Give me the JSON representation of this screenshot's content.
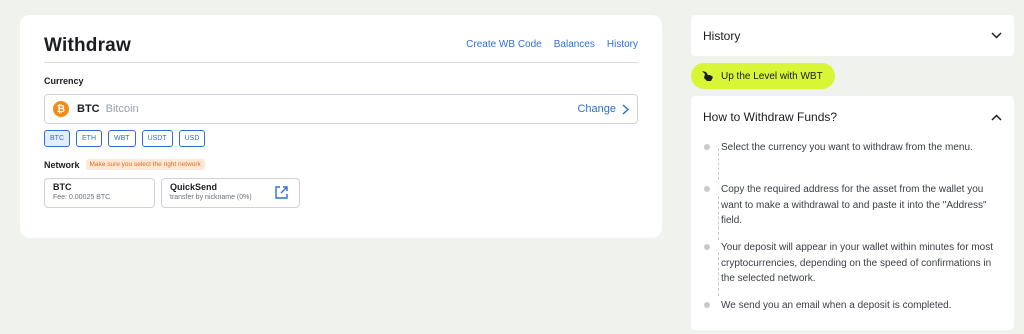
{
  "withdraw": {
    "title": "Withdraw",
    "links": [
      "Create WB Code",
      "Balances",
      "History"
    ],
    "currency_label": "Currency",
    "selected": {
      "code": "BTC",
      "name": "Bitcoin",
      "icon": "bitcoin-icon",
      "change_label": "Change"
    },
    "chips": [
      "BTC",
      "ETH",
      "WBT",
      "USDT",
      "USD"
    ],
    "network_label": "Network",
    "network_warning": "Make sure you select the right network",
    "networks": [
      {
        "name": "BTC",
        "sub": "Fee: 0.00025 BTC"
      },
      {
        "name": "QuickSend",
        "sub": "transfer by nickname (0%)"
      }
    ]
  },
  "sidebar": {
    "history_title": "History",
    "promo": "Up the Level with WBT",
    "howto_title": "How to Withdraw Funds?",
    "steps": [
      "Select the currency you want to withdraw from the menu.",
      "Copy the required address for the asset from the wallet you want to make a withdrawal to and paste it into the \"Address\" field.",
      "Your deposit will appear in your wallet within minutes for most cryptocurrencies, depending on the speed of confirmations in the selected network.",
      "We send you an email when a deposit is completed."
    ]
  },
  "colors": {
    "accent": "#2f6fd6",
    "promo": "#d8f536",
    "btc": "#f08c1a",
    "warning": "#e06c1b"
  }
}
